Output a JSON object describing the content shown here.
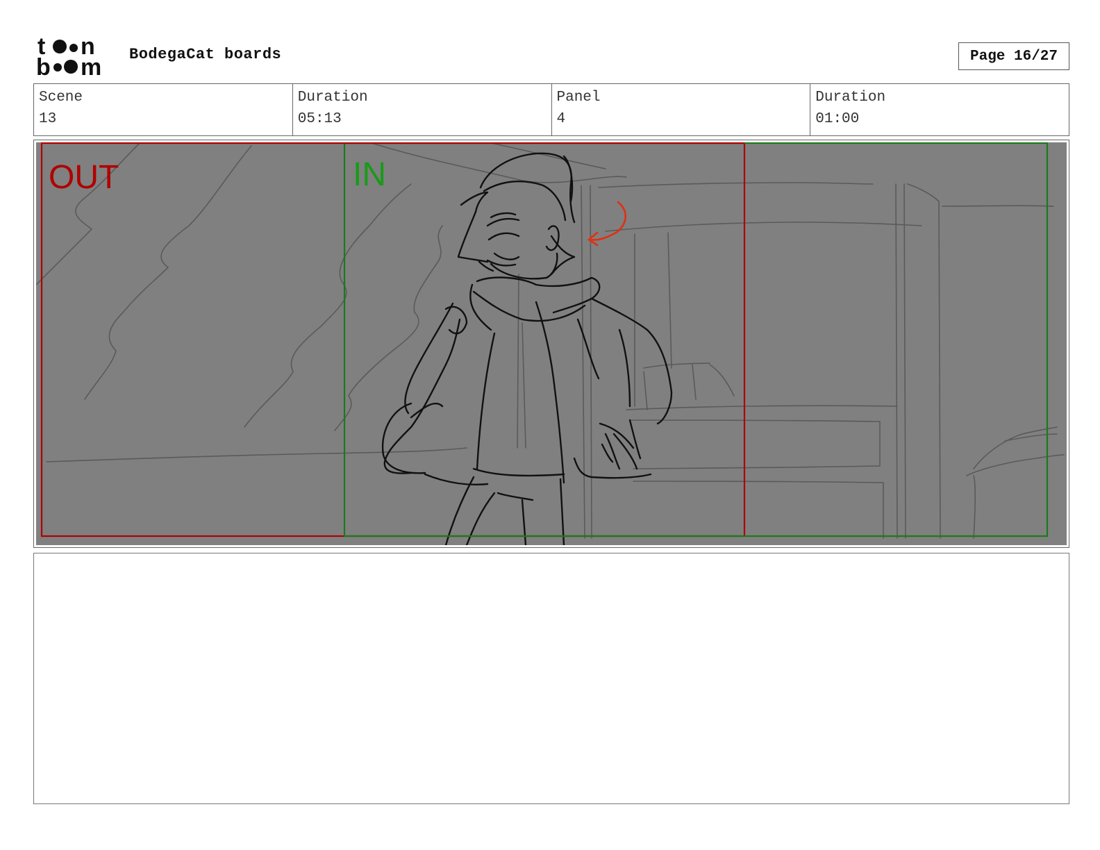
{
  "header": {
    "logo_text": "toon boom",
    "title": "BodegaCat boards",
    "page": "Page 16/27"
  },
  "info": {
    "scene_label": "Scene",
    "scene_value": "13",
    "scene_duration_label": "Duration",
    "scene_duration_value": "05:13",
    "panel_label": "Panel",
    "panel_value": "4",
    "panel_duration_label": "Duration",
    "panel_duration_value": "01:00"
  },
  "panel": {
    "out_label": "OUT",
    "in_label": "IN",
    "out_color": "#b00000",
    "in_color": "#1a9a1a",
    "background": "#808080"
  },
  "notes": {
    "text": ""
  }
}
